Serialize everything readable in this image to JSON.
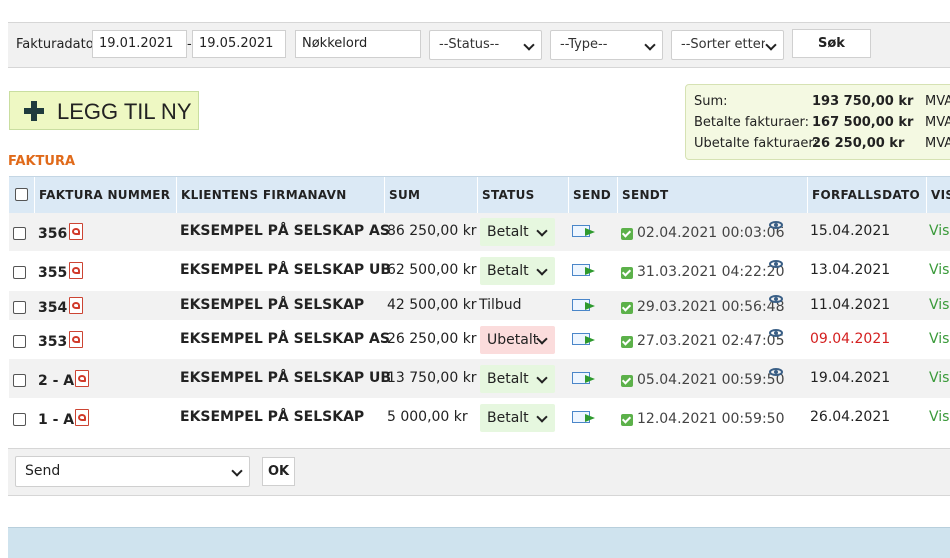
{
  "filter": {
    "date_label": "Fakturadato:",
    "date_from": "19.01.2021",
    "date_separator": "-",
    "date_to": "19.05.2021",
    "keyword": "Nøkkelord",
    "status_select": "--Status--",
    "type_select": "--Type--",
    "sort_select": "--Sorter etter",
    "search_button": "Søk"
  },
  "add_new_label": "LEGG TIL NY",
  "summary": {
    "rows": [
      {
        "label": "Sum:",
        "value": "193 750,00 kr",
        "suffix": "MVA"
      },
      {
        "label": "Betalte fakturaer:",
        "value": "167 500,00 kr",
        "suffix": "MVA"
      },
      {
        "label": "Ubetalte fakturaer:",
        "value": "26 250,00 kr",
        "suffix": "MVA"
      }
    ]
  },
  "section_title": "FAKTURA",
  "table": {
    "columns": [
      "FAKTURA NUMMER",
      "KLIENTENS FIRMANAVN",
      "SUM",
      "STATUS",
      "SEND",
      "SENDT",
      "FORFALLSDATO",
      "VIS"
    ],
    "rows": [
      {
        "number": "356",
        "firm": "EKSEMPEL PÅ SELSKAP AS",
        "sum": "86 250,00 kr",
        "status": "Betalt",
        "status_kind": "select-paid",
        "sent": "02.04.2021 00:03:06",
        "eye": true,
        "due": "15.04.2021",
        "due_late": false,
        "vis": "Vis"
      },
      {
        "number": "355",
        "firm": "EKSEMPEL PÅ SELSKAP UB",
        "sum": "62 500,00 kr",
        "status": "Betalt",
        "status_kind": "select-paid",
        "sent": "31.03.2021 04:22:20",
        "eye": true,
        "due": "13.04.2021",
        "due_late": false,
        "vis": "Vis"
      },
      {
        "number": "354",
        "firm": "EKSEMPEL PÅ SELSKAP",
        "sum": "42 500,00 kr",
        "status": "Tilbud",
        "status_kind": "text",
        "sent": "29.03.2021 00:56:48",
        "eye": true,
        "due": "11.04.2021",
        "due_late": false,
        "vis": "Vis"
      },
      {
        "number": "353",
        "firm": "EKSEMPEL PÅ SELSKAP AS",
        "sum": "26 250,00 kr",
        "status": "Ubetalt",
        "status_kind": "select-unpaid",
        "sent": "27.03.2021 02:47:05",
        "eye": true,
        "due": "09.04.2021",
        "due_late": true,
        "vis": "Vis"
      },
      {
        "number": "2 - A",
        "firm": "EKSEMPEL PÅ SELSKAP UB",
        "sum": "13 750,00 kr",
        "status": "Betalt",
        "status_kind": "select-paid",
        "sent": "05.04.2021 00:59:50",
        "eye": true,
        "due": "19.04.2021",
        "due_late": false,
        "vis": "Vis"
      },
      {
        "number": "1 - A",
        "firm": "EKSEMPEL PÅ SELSKAP",
        "sum": "5 000,00 kr",
        "status": "Betalt",
        "status_kind": "select-paid",
        "sent": "12.04.2021 00:59:50",
        "eye": false,
        "due": "26.04.2021",
        "due_late": false,
        "vis": "Vis"
      }
    ]
  },
  "bulk": {
    "action_select": "Send",
    "ok_button": "OK"
  },
  "colors": {
    "section_title": "#e06a1a",
    "header_bg": "#dbe9f5",
    "paid_bg": "#e6f7df",
    "unpaid_bg": "#fbdcdc",
    "late_due": "#d42020",
    "vis_link": "#3a9a3a"
  }
}
